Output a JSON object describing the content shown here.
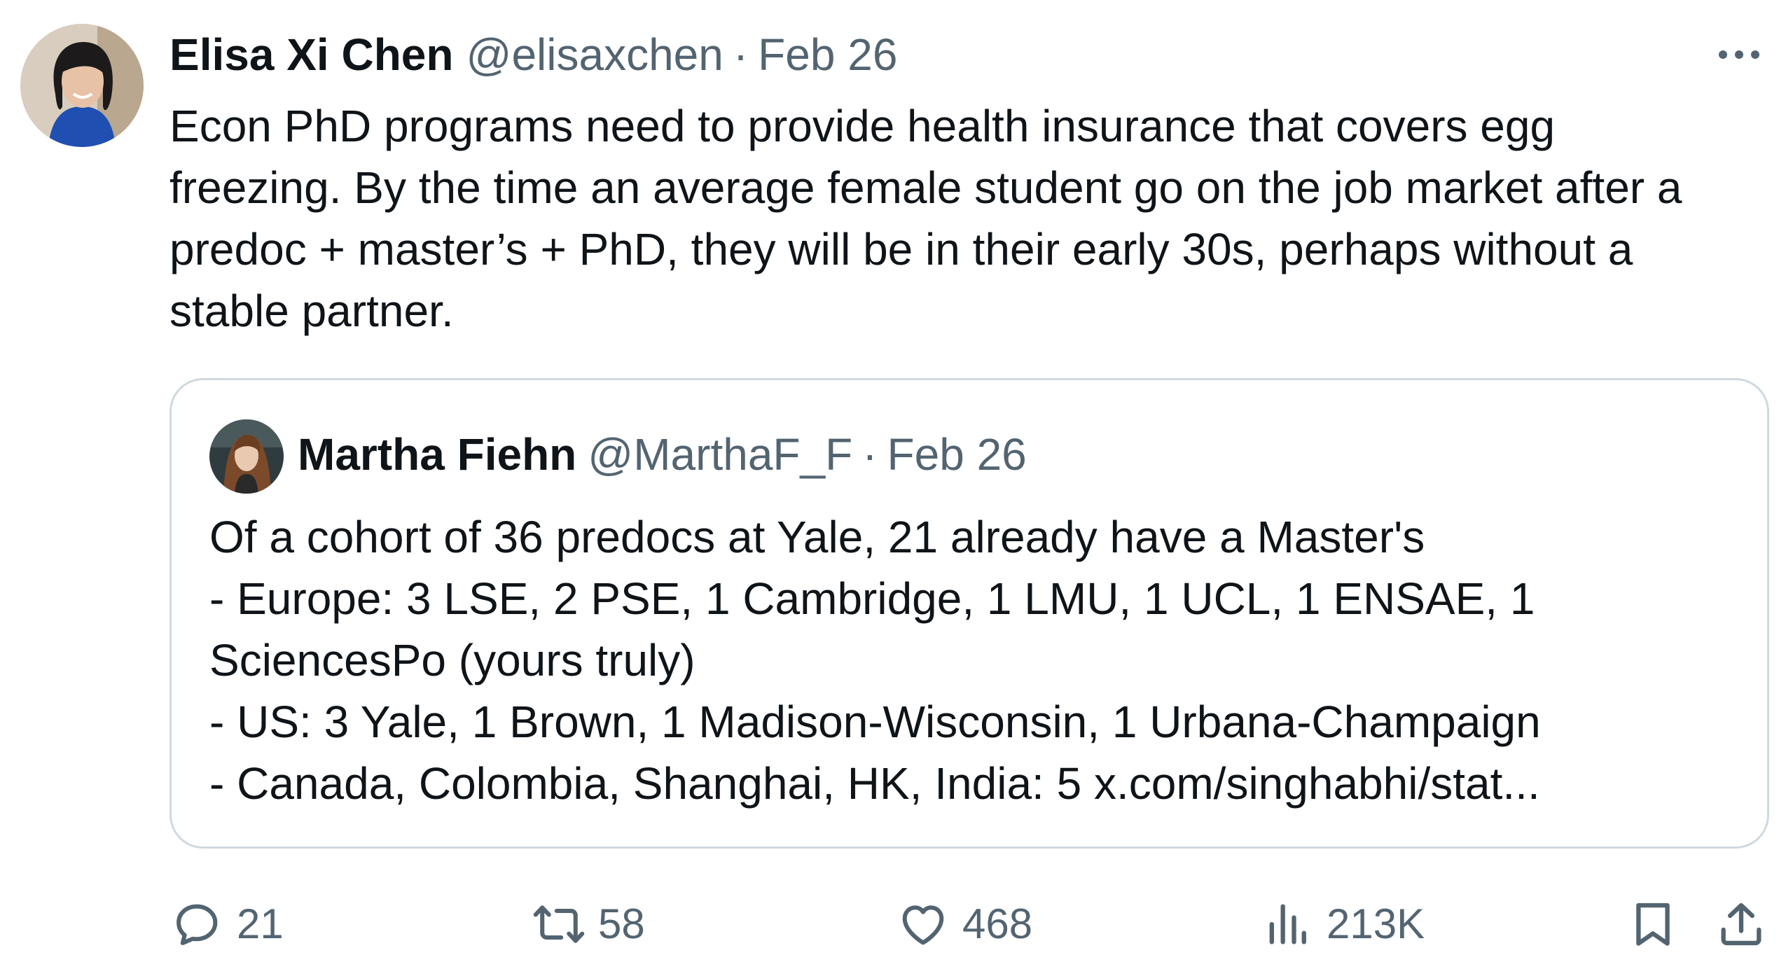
{
  "tweet": {
    "author": {
      "display_name": "Elisa Xi Chen",
      "handle": "@elisaxchen",
      "avatar_icon": "profile-photo"
    },
    "separator": "·",
    "date": "Feb 26",
    "more_icon": "more-horizontal-icon",
    "text": "Econ PhD programs need to provide health insurance that covers egg\nfreezing. By the time an average female student go on the job market after a\npredoc + master’s + PhD, they will be in their early 30s, perhaps without a\nstable partner."
  },
  "quoted_tweet": {
    "author": {
      "display_name": "Martha Fiehn",
      "handle": "@MarthaF_F",
      "avatar_icon": "profile-photo"
    },
    "separator": "·",
    "date": "Feb 26",
    "lines": [
      "Of a cohort of 36 predocs at Yale, 21 already have a Master's",
      "- Europe: 3 LSE, 2 PSE, 1 Cambridge, 1 LMU, 1 UCL, 1 ENSAE, 1\nSciencesPo (yours truly)",
      "- US: 3 Yale, 1 Brown, 1 Madison-Wisconsin, 1 Urbana-Champaign",
      "- Canada, Colombia, Shanghai, HK, India: 5 x.com/singhabhi/stat..."
    ]
  },
  "actions": {
    "reply": {
      "icon": "reply-icon",
      "count": "21"
    },
    "retweet": {
      "icon": "retweet-icon",
      "count": "58"
    },
    "like": {
      "icon": "heart-icon",
      "count": "468"
    },
    "views": {
      "icon": "views-icon",
      "count": "213K"
    },
    "bookmark": {
      "icon": "bookmark-icon"
    },
    "share": {
      "icon": "share-icon"
    }
  },
  "colors": {
    "text_primary": "#0f1419",
    "text_secondary": "#536471",
    "border": "#cfd9de",
    "background": "#ffffff"
  }
}
